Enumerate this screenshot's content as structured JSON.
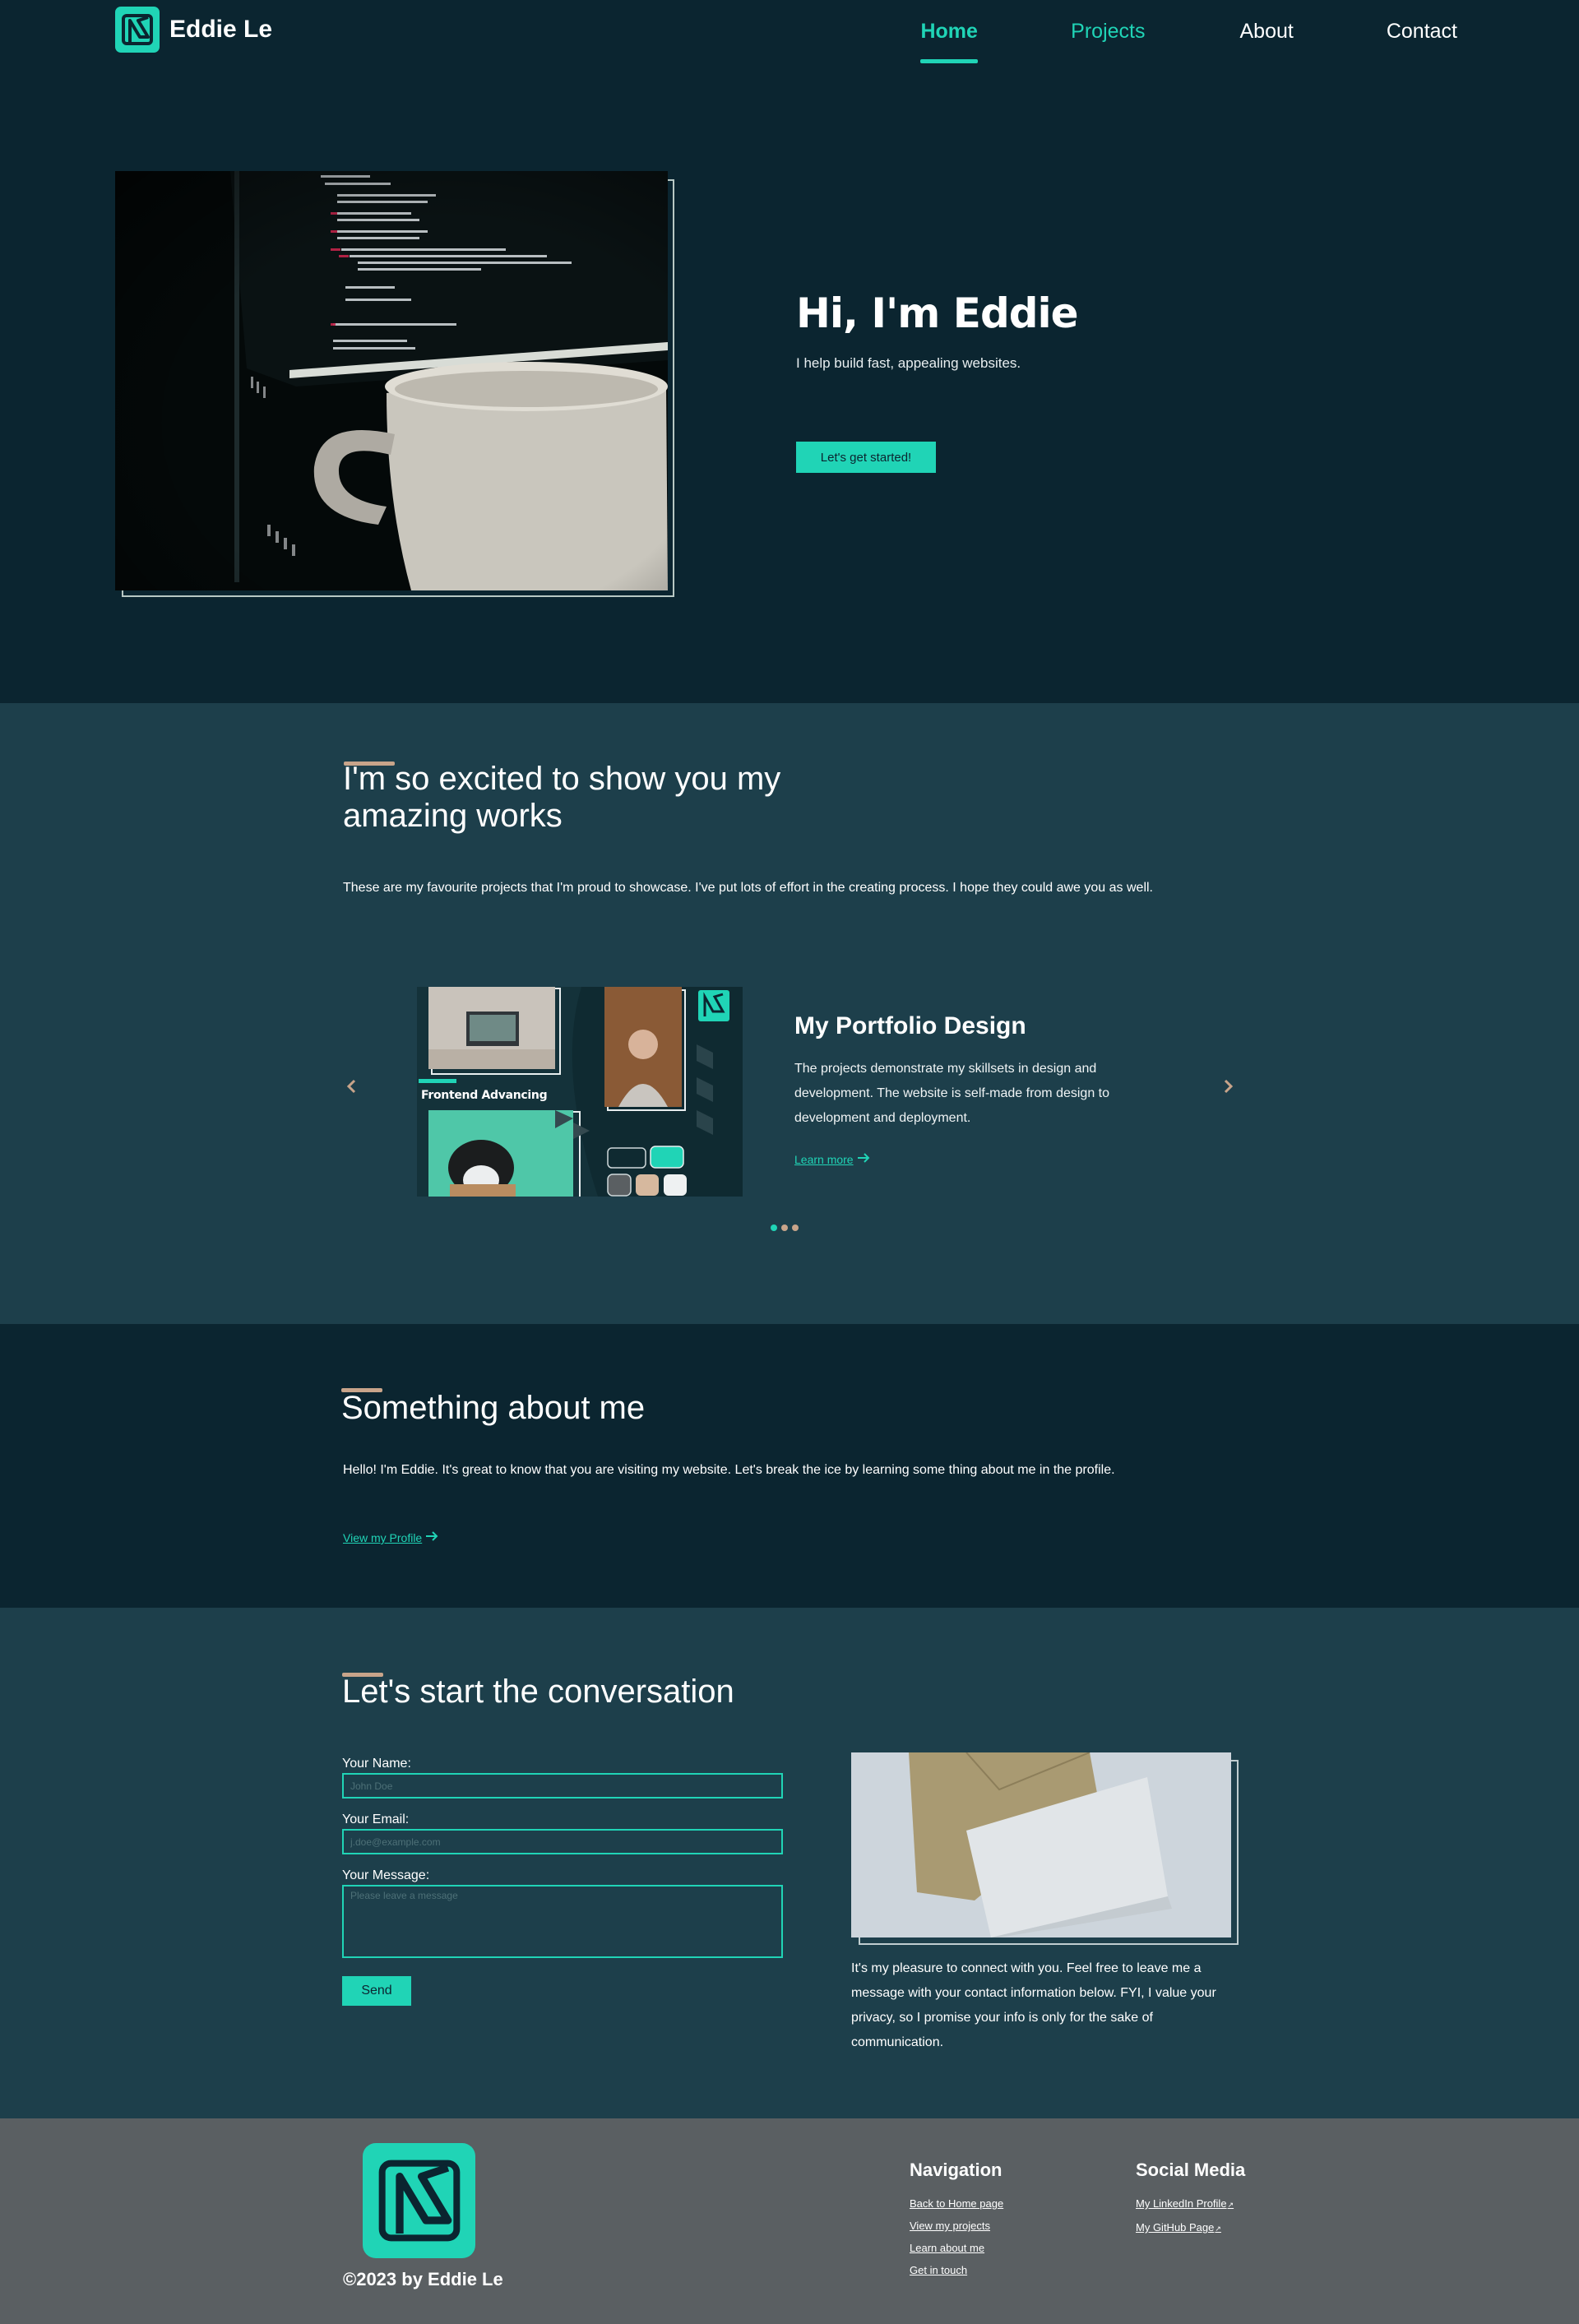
{
  "header": {
    "brand_name": "Eddie Le",
    "nav": [
      "Home",
      "Projects",
      "About",
      "Contact"
    ]
  },
  "hero": {
    "title": "Hi, I'm Eddie",
    "subtitle": "I help build fast, appealing websites.",
    "cta": "Let's get started!"
  },
  "works": {
    "title": "I'm so excited to show you my amazing works",
    "description": "These are my favourite projects that I'm proud to showcase. I've put lots of effort in the creating process.  I hope they could awe you as well.",
    "project": {
      "thumb_caption": "Frontend Advancing",
      "title": "My Portfolio Design",
      "description": "The projects demonstrate my skillsets in design and development. The website is self-made from design to development and deployment.",
      "link": "Learn more"
    },
    "slides_total": 3,
    "slide_active": 1
  },
  "about": {
    "title": "Something about me",
    "description": "Hello! I'm Eddie. It's great to know that you are visiting my website. Let's break the ice by learning some thing about me in the profile.",
    "link": "View my Profile"
  },
  "contact": {
    "title": "Let's start the conversation",
    "name_label": "Your Name:",
    "name_placeholder": "John Doe",
    "email_label": "Your Email:",
    "email_placeholder": "j.doe@example.com",
    "message_label": "Your Message:",
    "message_placeholder": "Please leave a message",
    "send": "Send",
    "text": "It's my pleasure to connect with you. Feel free to leave me a message with your contact information below. FYI, I value your privacy, so I promise your info is only for the sake of communication."
  },
  "footer": {
    "copyright": "©2023 by Eddie Le",
    "nav_title": "Navigation",
    "nav_links": [
      "Back to Home page",
      "View my projects",
      "Learn about me",
      "Get in touch"
    ],
    "social_title": "Social Media",
    "social_links": [
      "My LinkedIn Profile",
      "My GitHub Page"
    ]
  },
  "colors": {
    "accent": "#20d4b6",
    "dark_bg": "#0b2530",
    "section_bg": "#1d3f4b",
    "tan": "#c8a48a",
    "footer_bg": "#5a5f62"
  },
  "icons": {
    "logo": "eddie-le-logo-icon",
    "arrow": "arrow-right-icon",
    "chevron_left": "chevron-left-icon",
    "chevron_right": "chevron-right-icon",
    "external": "external-link-icon"
  }
}
